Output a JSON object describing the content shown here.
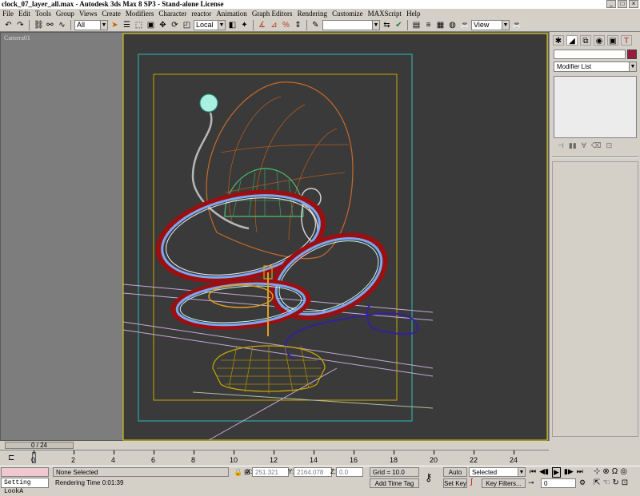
{
  "window": {
    "title": "clock_07_layer_all.max - Autodesk 3ds Max 8 SP3 - Stand-alone License"
  },
  "menu": [
    "File",
    "Edit",
    "Tools",
    "Group",
    "Views",
    "Create",
    "Modifiers",
    "Character",
    "reactor",
    "Animation",
    "Graph Editors",
    "Rendering",
    "Customize",
    "MAXScript",
    "Help"
  ],
  "toolbar": {
    "selection_filter": "All",
    "coord_system": "Local",
    "named_selection": "",
    "view_label": "View"
  },
  "viewport": {
    "label": "Camera01"
  },
  "command_panel": {
    "tabs": [
      "create-icon",
      "modify-icon",
      "hierarchy-icon",
      "motion-icon",
      "display-icon",
      "utilities-icon"
    ],
    "object_name": "",
    "color": "#9b1a3a",
    "modifier_list": "Modifier List"
  },
  "timeline": {
    "frame_box": "0 / 24",
    "ticks": [
      "0",
      "2",
      "4",
      "6",
      "8",
      "10",
      "12",
      "14",
      "16",
      "18",
      "20",
      "22",
      "24"
    ]
  },
  "status": {
    "maxscript": "Setting LookA",
    "selection": "None Selected",
    "render_time": "Rendering Time  0:01:39",
    "x_label": "X:",
    "x_value": "251.321",
    "y_label": "Y:",
    "y_value": "2164.078",
    "z_label": "Z:",
    "z_value": "0.0",
    "grid": "Grid = 10.0",
    "add_time_tag": "Add Time Tag",
    "auto_key": "Auto Key",
    "set_key": "Set Key",
    "key_mode": "Selected",
    "key_filters": "Key Filters...",
    "current_frame": "0"
  }
}
